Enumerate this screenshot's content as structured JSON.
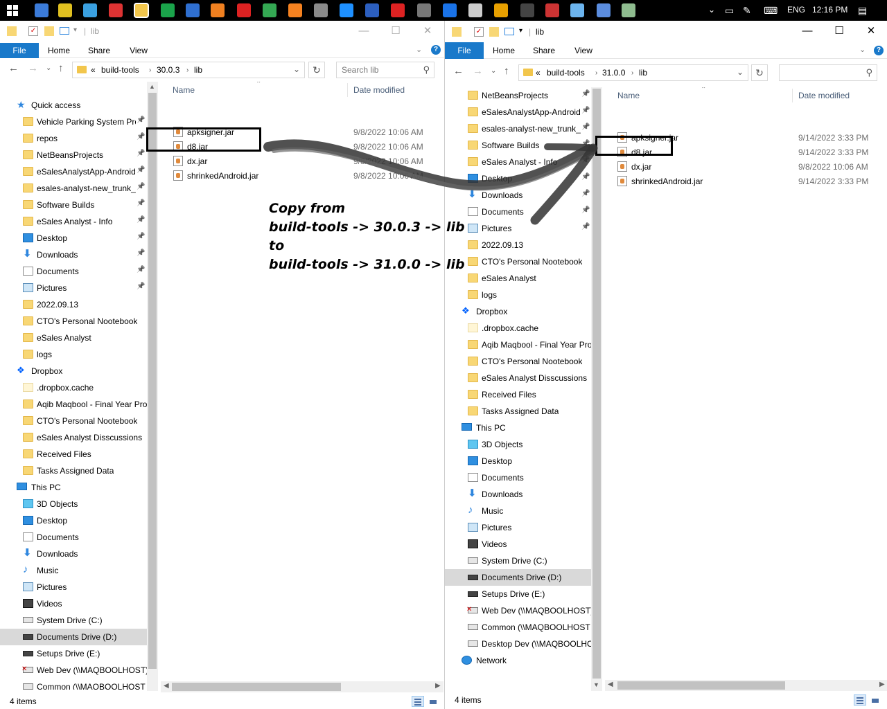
{
  "taskbar": {
    "language": "ENG",
    "time": "12:16 PM"
  },
  "left_window": {
    "title": "lib",
    "ribbon": {
      "file": "File",
      "home": "Home",
      "share": "Share",
      "view": "View"
    },
    "address": {
      "overflow": "«",
      "segments": [
        "build-tools",
        "30.0.3",
        "lib"
      ]
    },
    "search_placeholder": "Search lib",
    "nav": [
      {
        "label": "Quick access",
        "icon": "star-icon",
        "header": true
      },
      {
        "label": "Vehicle Parking System Pro",
        "icon": "folder-icon",
        "pin": true
      },
      {
        "label": "repos",
        "icon": "folder-icon",
        "pin": true
      },
      {
        "label": "NetBeansProjects",
        "icon": "folder-icon",
        "pin": true
      },
      {
        "label": "eSalesAnalystApp-Android",
        "icon": "folder-icon",
        "pin": true
      },
      {
        "label": "esales-analyst-new_trunk_e",
        "icon": "folder-icon",
        "pin": true
      },
      {
        "label": "Software Builds",
        "icon": "folder-icon",
        "pin": true
      },
      {
        "label": "eSales Analyst - Info",
        "icon": "folder-icon",
        "pin": true
      },
      {
        "label": "Desktop",
        "icon": "desktop-icon",
        "pin": true
      },
      {
        "label": "Downloads",
        "icon": "download-icon",
        "pin": true
      },
      {
        "label": "Documents",
        "icon": "documents-icon",
        "pin": true
      },
      {
        "label": "Pictures",
        "icon": "pictures-icon",
        "pin": true
      },
      {
        "label": "2022.09.13",
        "icon": "folder-icon"
      },
      {
        "label": "CTO's Personal Nootebook",
        "icon": "folder-icon"
      },
      {
        "label": "eSales Analyst",
        "icon": "folder-icon"
      },
      {
        "label": "logs",
        "icon": "folder-icon"
      },
      {
        "label": "Dropbox",
        "icon": "dropbox-icon",
        "header": true
      },
      {
        "label": ".dropbox.cache",
        "icon": "folder-pale-icon"
      },
      {
        "label": "Aqib Maqbool - Final Year Pro",
        "icon": "folder-icon"
      },
      {
        "label": "CTO's Personal Nootebook",
        "icon": "folder-icon"
      },
      {
        "label": "eSales Analyst Disscussions",
        "icon": "folder-icon"
      },
      {
        "label": "Received Files",
        "icon": "folder-icon"
      },
      {
        "label": "Tasks Assigned Data",
        "icon": "folder-icon"
      },
      {
        "label": "This PC",
        "icon": "pc-icon",
        "header": true
      },
      {
        "label": "3D Objects",
        "icon": "cube-icon"
      },
      {
        "label": "Desktop",
        "icon": "desktop-icon"
      },
      {
        "label": "Documents",
        "icon": "documents-icon"
      },
      {
        "label": "Downloads",
        "icon": "download-icon"
      },
      {
        "label": "Music",
        "icon": "music-icon"
      },
      {
        "label": "Pictures",
        "icon": "pictures-icon"
      },
      {
        "label": "Videos",
        "icon": "videos-icon"
      },
      {
        "label": "System Drive (C:)",
        "icon": "drive-icon"
      },
      {
        "label": "Documents Drive (D:)",
        "icon": "drive-dark-icon",
        "selected": true
      },
      {
        "label": "Setups Drive (E:)",
        "icon": "drive-dark-icon"
      },
      {
        "label": "Web Dev (\\\\MAQBOOLHOST)",
        "icon": "network-drive-disconnected-icon"
      },
      {
        "label": "Common (\\\\MAQBOOLHOST",
        "icon": "network-drive-icon"
      }
    ],
    "columns": {
      "name": "Name",
      "date": "Date modified"
    },
    "files": [
      {
        "name": "apksigner.jar",
        "date": "9/8/2022 10:06 AM"
      },
      {
        "name": "d8.jar",
        "date": "9/8/2022 10:06 AM"
      },
      {
        "name": "dx.jar",
        "date": "9/8/2022 10:06 AM"
      },
      {
        "name": "shrinkedAndroid.jar",
        "date": "9/8/2022 10:06 AM"
      }
    ],
    "status": "4 items"
  },
  "right_window": {
    "title": "lib",
    "ribbon": {
      "file": "File",
      "home": "Home",
      "share": "Share",
      "view": "View"
    },
    "address": {
      "overflow": "«",
      "segments": [
        "build-tools",
        "31.0.0",
        "lib"
      ]
    },
    "search_placeholder": "",
    "nav": [
      {
        "label": "NetBeansProjects",
        "icon": "folder-icon",
        "pin": true
      },
      {
        "label": "eSalesAnalystApp-Android",
        "icon": "folder-icon",
        "pin": true
      },
      {
        "label": "esales-analyst-new_trunk_e",
        "icon": "folder-icon",
        "pin": true
      },
      {
        "label": "Software Builds",
        "icon": "folder-icon",
        "pin": true
      },
      {
        "label": "eSales Analyst - Info",
        "icon": "folder-icon",
        "pin": true
      },
      {
        "label": "Desktop",
        "icon": "desktop-icon",
        "pin": true
      },
      {
        "label": "Downloads",
        "icon": "download-icon",
        "pin": true
      },
      {
        "label": "Documents",
        "icon": "documents-icon",
        "pin": true
      },
      {
        "label": "Pictures",
        "icon": "pictures-icon",
        "pin": true
      },
      {
        "label": "2022.09.13",
        "icon": "folder-icon"
      },
      {
        "label": "CTO's Personal Nootebook",
        "icon": "folder-icon"
      },
      {
        "label": "eSales Analyst",
        "icon": "folder-icon"
      },
      {
        "label": "logs",
        "icon": "folder-icon"
      },
      {
        "label": "Dropbox",
        "icon": "dropbox-icon",
        "header": true
      },
      {
        "label": ".dropbox.cache",
        "icon": "folder-pale-icon"
      },
      {
        "label": "Aqib Maqbool - Final Year Pro",
        "icon": "folder-icon"
      },
      {
        "label": "CTO's Personal Nootebook",
        "icon": "folder-icon"
      },
      {
        "label": "eSales Analyst Disscussions",
        "icon": "folder-icon"
      },
      {
        "label": "Received Files",
        "icon": "folder-icon"
      },
      {
        "label": "Tasks Assigned Data",
        "icon": "folder-icon"
      },
      {
        "label": "This PC",
        "icon": "pc-icon",
        "header": true
      },
      {
        "label": "3D Objects",
        "icon": "cube-icon"
      },
      {
        "label": "Desktop",
        "icon": "desktop-icon"
      },
      {
        "label": "Documents",
        "icon": "documents-icon"
      },
      {
        "label": "Downloads",
        "icon": "download-icon"
      },
      {
        "label": "Music",
        "icon": "music-icon"
      },
      {
        "label": "Pictures",
        "icon": "pictures-icon"
      },
      {
        "label": "Videos",
        "icon": "videos-icon"
      },
      {
        "label": "System Drive (C:)",
        "icon": "drive-icon"
      },
      {
        "label": "Documents Drive (D:)",
        "icon": "drive-dark-icon",
        "selected": true
      },
      {
        "label": "Setups Drive (E:)",
        "icon": "drive-dark-icon"
      },
      {
        "label": "Web Dev (\\\\MAQBOOLHOST)",
        "icon": "network-drive-disconnected-icon"
      },
      {
        "label": "Common (\\\\MAQBOOLHOST",
        "icon": "network-drive-icon"
      },
      {
        "label": "Desktop Dev (\\\\MAQBOOLHO",
        "icon": "network-drive-icon"
      },
      {
        "label": "Network",
        "icon": "network-icon",
        "header": true
      }
    ],
    "columns": {
      "name": "Name",
      "date": "Date modified"
    },
    "files": [
      {
        "name": "apksigner.jar",
        "date": "9/14/2022 3:33 PM"
      },
      {
        "name": "d8.jar",
        "date": "9/14/2022 3:33 PM"
      },
      {
        "name": "dx.jar",
        "date": "9/8/2022 10:06 AM"
      },
      {
        "name": "shrinkedAndroid.jar",
        "date": "9/14/2022 3:33 PM"
      }
    ],
    "status": "4 items"
  },
  "annotation": {
    "lines": [
      "Copy from",
      "build-tools -> 30.0.3 -> lib",
      "to",
      "build-tools -> 31.0.0 -> lib"
    ]
  }
}
